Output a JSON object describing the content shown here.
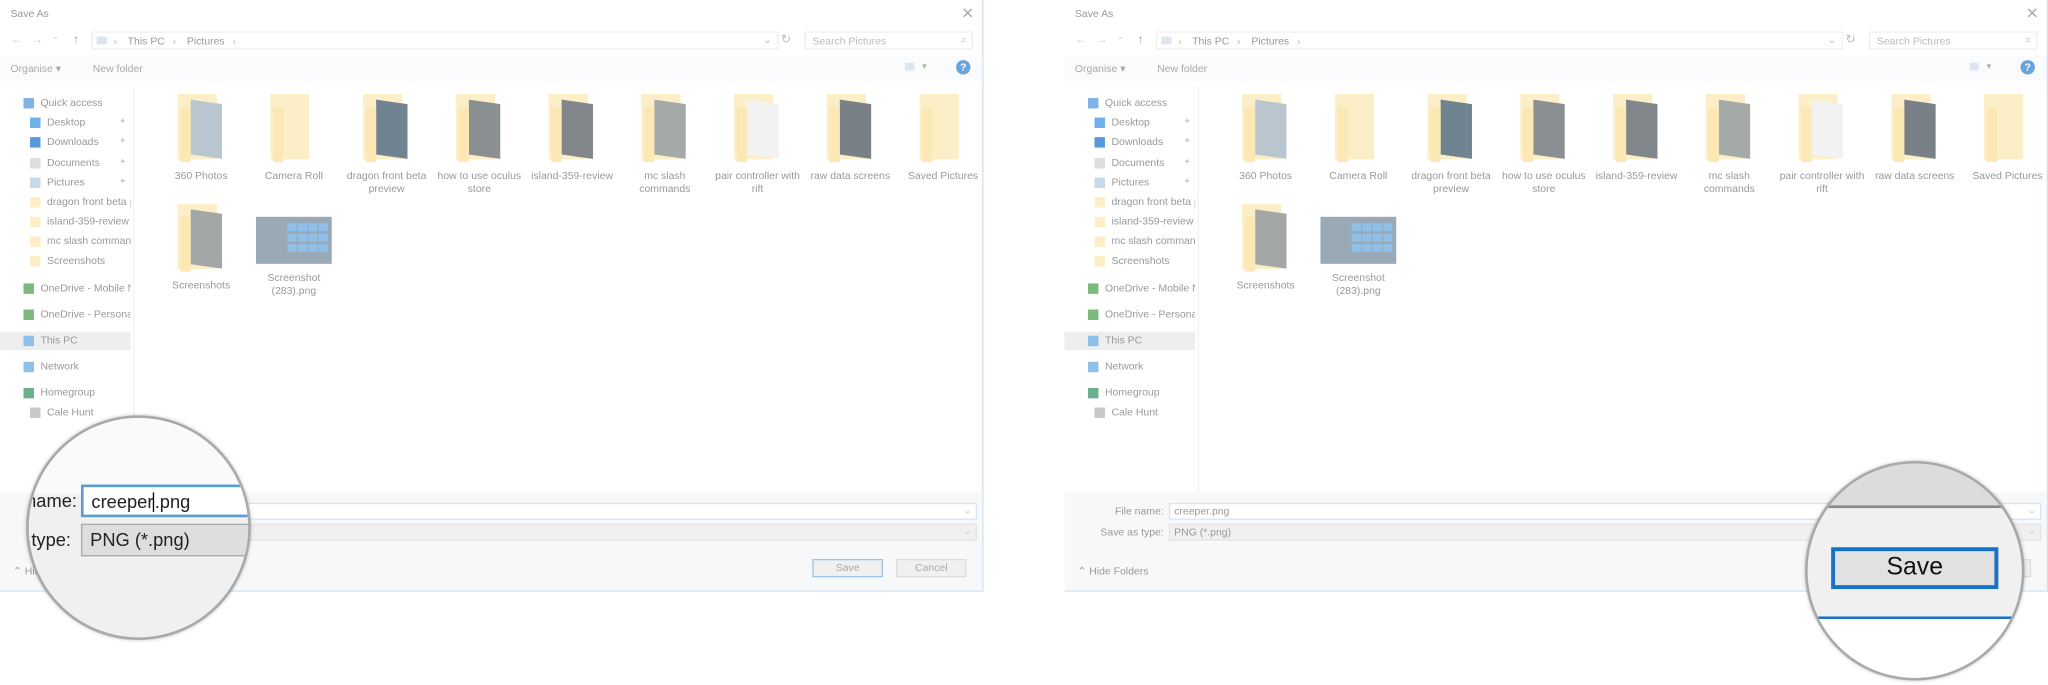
{
  "dialog": {
    "title": "Save As",
    "close_icon": "close-icon",
    "nav": {
      "back": "←",
      "forward": "→",
      "recent": "⌄",
      "up": "↑"
    },
    "breadcrumbs": [
      "This PC",
      "Pictures"
    ],
    "search_placeholder": "Search Pictures",
    "toolbar": {
      "organise": "Organise ▾",
      "new_folder": "New folder",
      "help": "?"
    },
    "nav_pane": [
      {
        "label": "Quick access",
        "icon": "star-icon",
        "color": "#7fb3e6"
      },
      {
        "label": "Desktop",
        "icon": "desktop-icon",
        "color": "#6fb0e8",
        "pinned": true
      },
      {
        "label": "Downloads",
        "icon": "download-icon",
        "color": "#5a98dc",
        "pinned": true
      },
      {
        "label": "Documents",
        "icon": "documents-icon",
        "color": "#dddddd",
        "pinned": true
      },
      {
        "label": "Pictures",
        "icon": "pictures-icon",
        "color": "#c7d8e8",
        "pinned": true
      },
      {
        "label": "dragon front beta p",
        "icon": "folder-icon",
        "color": "#fcefc7"
      },
      {
        "label": "island-359-review",
        "icon": "folder-icon",
        "color": "#fcefc7"
      },
      {
        "label": "mc slash command",
        "icon": "folder-icon",
        "color": "#fcefc7"
      },
      {
        "label": "Screenshots",
        "icon": "folder-icon",
        "color": "#fcefc7"
      },
      {
        "label": "OneDrive - Mobile N",
        "icon": "onedrive-icon",
        "color": "#7cba7c"
      },
      {
        "label": "OneDrive - Personal",
        "icon": "onedrive-icon",
        "color": "#7cba7c"
      },
      {
        "label": "This PC",
        "icon": "computer-icon",
        "color": "#8fc0ea",
        "selected": true
      },
      {
        "label": "Network",
        "icon": "network-icon",
        "color": "#8fc0ea"
      },
      {
        "label": "Homegroup",
        "icon": "homegroup-icon",
        "color": "#6ab08e"
      },
      {
        "label": "Cale Hunt",
        "icon": "user-icon",
        "color": "#c8c8c8"
      }
    ],
    "items": [
      {
        "label": "360 Photos",
        "type": "folder",
        "preview": "#b9c6cf"
      },
      {
        "label": "Camera Roll",
        "type": "folder"
      },
      {
        "label": "dragon front beta preview",
        "type": "folder",
        "preview": "#6f8490"
      },
      {
        "label": "how to use oculus store",
        "type": "folder",
        "preview": "#8a8f92"
      },
      {
        "label": "island-359-review",
        "type": "folder",
        "preview": "#80868a"
      },
      {
        "label": "mc slash commands",
        "type": "folder",
        "preview": "#a4aaa8"
      },
      {
        "label": "pair controller with rift",
        "type": "folder",
        "preview": "#f2f2f2"
      },
      {
        "label": "raw data screens",
        "type": "folder",
        "preview": "#7a8088"
      },
      {
        "label": "Saved Pictures",
        "type": "folder"
      },
      {
        "label": "Screenshots",
        "type": "folder",
        "preview": "#a3a8a6"
      },
      {
        "label": "Screenshot (283).png",
        "type": "image"
      }
    ],
    "file_name_label": "File name:",
    "file_name": "creeper.png",
    "save_type_label": "Save as type:",
    "save_type": "PNG (*.png)",
    "hide_folders": "Hide Folders",
    "save": "Save",
    "cancel": "Cancel"
  },
  "magnifier_left": {
    "name_label": "name:",
    "type_label": "type:",
    "file_name_before_caret": "creeper",
    "file_name_after_caret": ".png",
    "save_type": "PNG (*.png)"
  },
  "magnifier_right": {
    "save": "Save"
  },
  "accent_color": "#1673c8"
}
